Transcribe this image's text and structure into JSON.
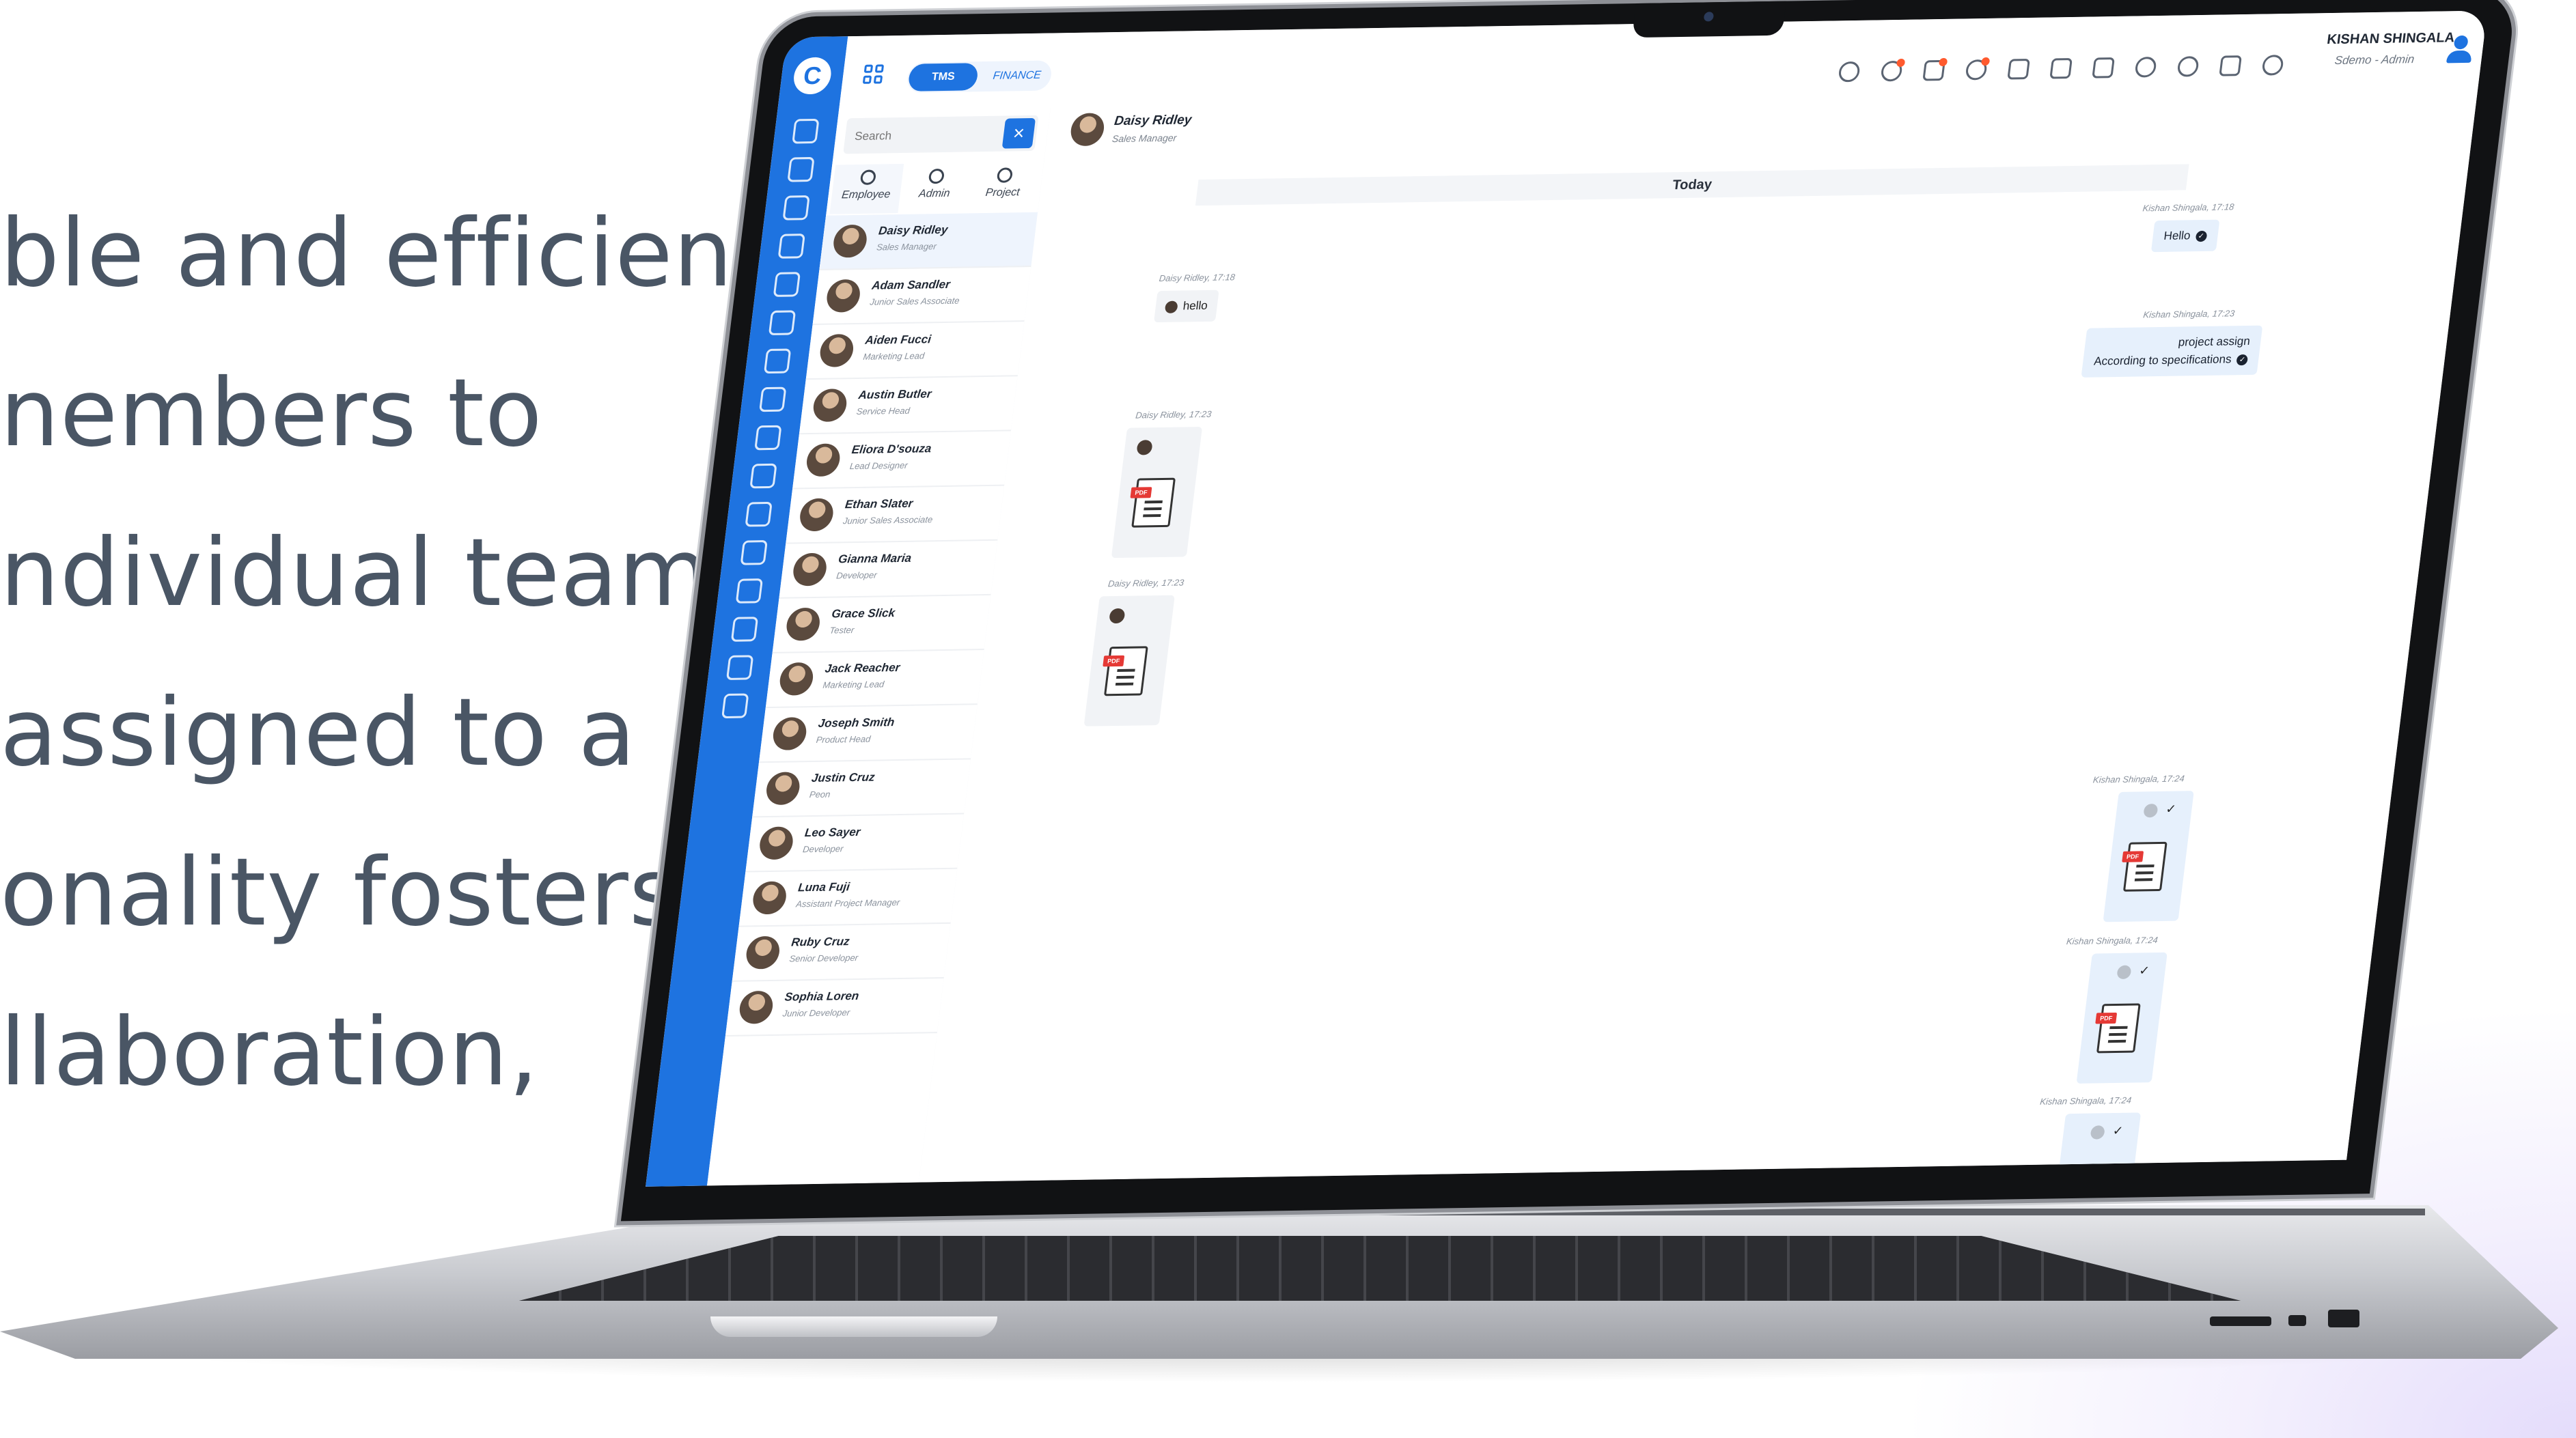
{
  "marketing": {
    "lines": [
      "ble and efficient",
      "nembers to",
      "ndividual team",
      "assigned to a",
      "onality fosters",
      "llaboration,"
    ]
  },
  "app": {
    "logo_letter": "C",
    "toggle": {
      "active": "TMS",
      "inactive": "FINANCE"
    },
    "user": {
      "name": "KISHAN SHINGALA",
      "role": "Sdemo - Admin"
    },
    "accent_color": "#1e73e0"
  },
  "panel": {
    "search_placeholder": "Search",
    "tabs": [
      {
        "label": "Employee",
        "icon": "employee-icon"
      },
      {
        "label": "Admin",
        "icon": "admin-icon"
      },
      {
        "label": "Project",
        "icon": "project-icon"
      }
    ],
    "contacts": [
      {
        "name": "Daisy Ridley",
        "role": "Sales Manager"
      },
      {
        "name": "Adam Sandler",
        "role": "Junior Sales Associate"
      },
      {
        "name": "Aiden Fucci",
        "role": "Marketing Lead"
      },
      {
        "name": "Austin Butler",
        "role": "Service Head"
      },
      {
        "name": "Eliora D'souza",
        "role": "Lead Designer"
      },
      {
        "name": "Ethan Slater",
        "role": "Junior Sales Associate"
      },
      {
        "name": "Gianna Maria",
        "role": "Developer"
      },
      {
        "name": "Grace Slick",
        "role": "Tester"
      },
      {
        "name": "Jack Reacher",
        "role": "Marketing Lead"
      },
      {
        "name": "Joseph Smith",
        "role": "Product Head"
      },
      {
        "name": "Justin Cruz",
        "role": "Peon"
      },
      {
        "name": "Leo Sayer",
        "role": "Developer"
      },
      {
        "name": "Luna Fuji",
        "role": "Assistant Project Manager"
      },
      {
        "name": "Ruby Cruz",
        "role": "Senior Developer"
      },
      {
        "name": "Sophia Loren",
        "role": "Junior Developer"
      }
    ]
  },
  "chat": {
    "header": {
      "name": "Daisy Ridley",
      "role": "Sales Manager"
    },
    "day_divider": "Today",
    "messages": [
      {
        "meta": "Kishan Shingala, 17:18",
        "text": "Hello"
      },
      {
        "meta": "Daisy Ridley, 17:18",
        "text": "hello"
      },
      {
        "meta": "Kishan Shingala, 17:23",
        "text_line1": "project assign",
        "text_line2": "According to specifications"
      },
      {
        "meta": "Daisy Ridley, 17:23",
        "file": "PDF"
      },
      {
        "meta": "Daisy Ridley, 17:23",
        "file": "PDF"
      },
      {
        "meta": "Kishan Shingala, 17:24",
        "file": "PDF"
      },
      {
        "meta": "Kishan Shingala, 17:24",
        "file": "PDF"
      },
      {
        "meta": "Kishan Shingala, 17:24",
        "file": "PDF"
      }
    ]
  }
}
